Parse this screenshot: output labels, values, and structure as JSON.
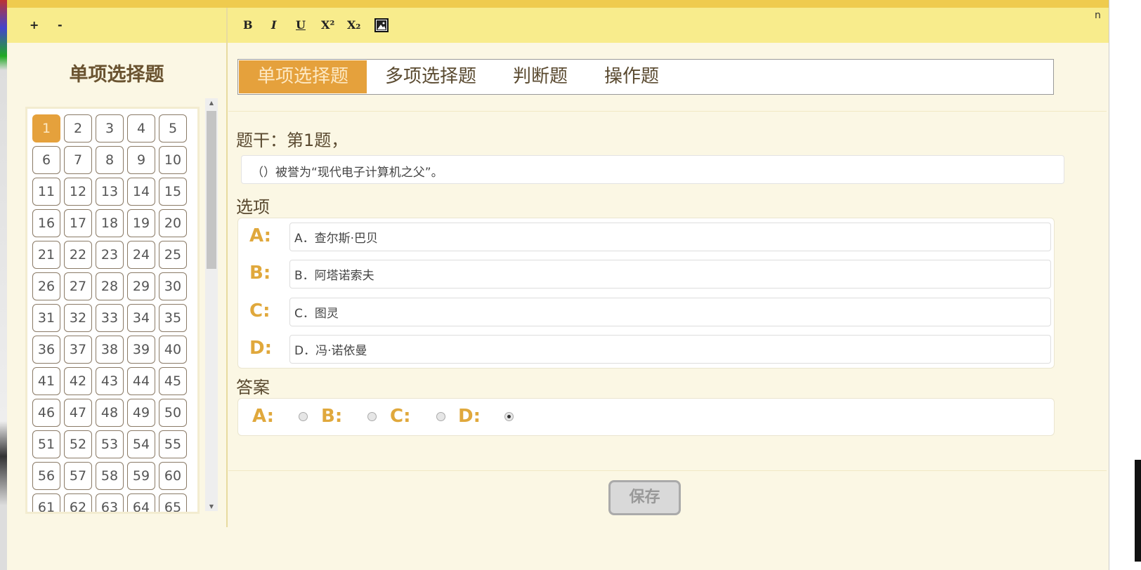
{
  "toolbar": {
    "zoom_in": "+",
    "zoom_out": "-",
    "bold": "B",
    "italic": "I",
    "underline": "U",
    "superscript": "X²",
    "subscript": "X₂",
    "image_icon": "image-icon"
  },
  "sidebar": {
    "title": "单项选择题",
    "numbers": [
      1,
      2,
      3,
      4,
      5,
      6,
      7,
      8,
      9,
      10,
      11,
      12,
      13,
      14,
      15,
      16,
      17,
      18,
      19,
      20,
      21,
      22,
      23,
      24,
      25,
      26,
      27,
      28,
      29,
      30,
      31,
      32,
      33,
      34,
      35,
      36,
      37,
      38,
      39,
      40,
      41,
      42,
      43,
      44,
      45,
      46,
      47,
      48,
      49,
      50,
      51,
      52,
      53,
      54,
      55,
      56,
      57,
      58,
      59,
      60,
      61,
      62,
      63,
      64,
      65
    ],
    "active": 1
  },
  "tabs": [
    {
      "label": "单项选择题"
    },
    {
      "label": "多项选择题"
    },
    {
      "label": "判断题"
    },
    {
      "label": "操作题"
    }
  ],
  "question": {
    "label": "题干：第1题，",
    "stem": "（）被誉为“现代电子计算机之父”。"
  },
  "options": {
    "label": "选项",
    "items": [
      {
        "letter": "A:",
        "text": "A．查尔斯·巴贝"
      },
      {
        "letter": "B:",
        "text": "B．阿塔诺索夫"
      },
      {
        "letter": "C:",
        "text": "C．图灵"
      },
      {
        "letter": "D:",
        "text": "D．冯·诺依曼"
      }
    ]
  },
  "answer": {
    "label": "答案",
    "choices": [
      {
        "letter": "A:",
        "checked": false
      },
      {
        "letter": "B:",
        "checked": false
      },
      {
        "letter": "C:",
        "checked": false
      },
      {
        "letter": "D:",
        "checked": true
      }
    ]
  },
  "save_label": "保存",
  "edge_text": "n",
  "colors": {
    "accent": "#e5a13c",
    "toolbar": "#f8ec8c",
    "background": "#fbf7e4"
  }
}
